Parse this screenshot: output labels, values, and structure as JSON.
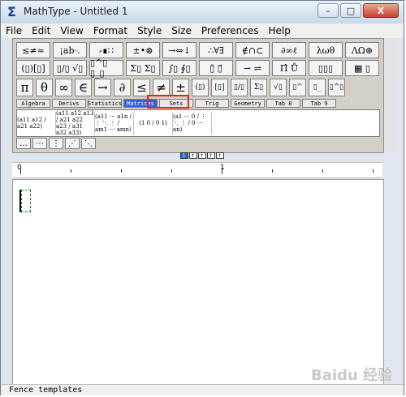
{
  "window": {
    "title": "MathType - Untitled 1",
    "app_icon": "sigma-icon"
  },
  "window_controls": {
    "minimize": "–",
    "maximize": "□",
    "close": "X"
  },
  "menu": [
    "File",
    "Edit",
    "View",
    "Format",
    "Style",
    "Size",
    "Preferences",
    "Help"
  ],
  "toolbar": {
    "row1": [
      "≤≠≈",
      "¡ab·.",
      "⸗∎∷",
      "±•⊗",
      "→⇔↓",
      "∴∀∃",
      "∉∩⊂",
      "∂∞ℓ",
      "λωθ",
      "ΛΩ⊛"
    ],
    "row2": [
      "(▯)[▯]",
      "▯/▯ √▯",
      "▯^▯ ▯_▯",
      "Σ▯ Σ▯",
      "∫▯ ∮▯",
      "▯̄ ▯⃗",
      "⇀ ⇌",
      "Π̂ Ů",
      "▯▯▯",
      "▦ ▯"
    ],
    "row3": [
      "π",
      "θ",
      "∞",
      "∈",
      "→",
      "∂",
      "≤",
      "≠",
      "±",
      "(▯)",
      "[▯]",
      "▯/▯",
      "Σ▯",
      "√▯",
      "▯^",
      "▯_",
      "▯^▯"
    ],
    "tabs": [
      "Algebra",
      "Derivs",
      "Statistics",
      "Matrices",
      "Sets",
      "Trig",
      "Geometry",
      "Tab 8",
      "Tab 9"
    ],
    "active_tab": "Matrices",
    "templates": [
      "2x2 matrix",
      "3x3 matrix",
      "n x n matrix",
      "2x2 identity",
      "diagonal"
    ],
    "template_glyphs": {
      "t1": "(a11 a12 / a21 a22)",
      "t2": "(a11 a12 a13 / a21 a22 a23 / a31 a32 a33)",
      "t3": "(a11 ⋯ a1n / ⋮ ⋱ ⋮ / am1 ⋯ amn)",
      "t4": "(1 0 / 0 1)",
      "t5": "(a1 ⋯ 0 / ⋮ ⋱ ⋮ / 0 ⋯ an)"
    },
    "dots": [
      "…",
      "⋯",
      "⋮",
      "⋰",
      "⋱"
    ]
  },
  "size_buttons": [
    "1",
    "↑",
    "↑",
    "↑",
    "↑"
  ],
  "ruler": {
    "labels": [
      "0",
      "1"
    ]
  },
  "status": {
    "text": "Fence templates"
  },
  "watermark": {
    "text": "Baidu 经验"
  }
}
